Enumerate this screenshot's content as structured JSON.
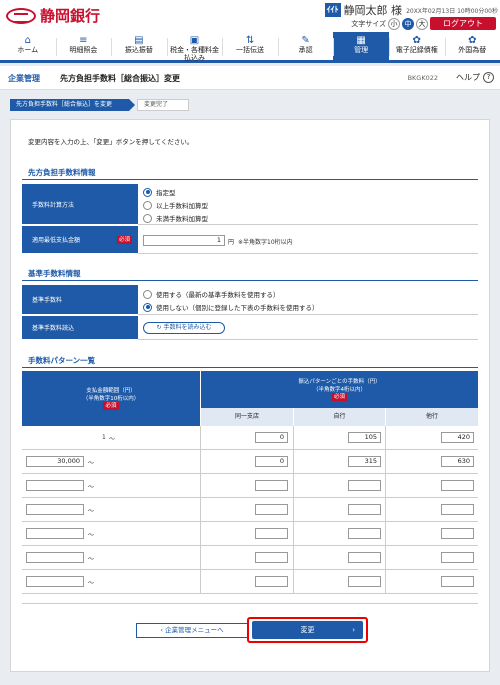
{
  "header": {
    "bank_name": "静岡銀行",
    "user_id_badge": "ｲｲﾄ",
    "user_name": "静岡太郎 様",
    "login_time": "20XX年02月13日 10時00分00秒",
    "text_size_label": "文字サイズ",
    "text_sizes": [
      "小",
      "中",
      "大"
    ],
    "logout_label": "ログアウト"
  },
  "nav": [
    {
      "label": "ホーム",
      "icon": "home-icon",
      "glyph": "⌂"
    },
    {
      "label": "明細照会",
      "icon": "list-icon",
      "glyph": "≡"
    },
    {
      "label": "振込振替",
      "icon": "transfer-icon",
      "glyph": "▤"
    },
    {
      "label": "税金・各種料金\n払込み",
      "icon": "tax-icon",
      "glyph": "▣"
    },
    {
      "label": "一括伝送",
      "icon": "batch-icon",
      "glyph": "⇅"
    },
    {
      "label": "承認",
      "icon": "approve-icon",
      "glyph": "✎"
    },
    {
      "label": "管理",
      "icon": "admin-icon",
      "glyph": "▦"
    },
    {
      "label": "電子記録債権",
      "icon": "e-claim-icon",
      "glyph": "✿"
    },
    {
      "label": "外国為替",
      "icon": "forex-icon",
      "glyph": "✿"
    }
  ],
  "titlebar": {
    "category": "企業管理",
    "title": "先方負担手数料［総合振込］変更",
    "page_id": "BKGK022",
    "help_label": "ヘルプ",
    "help_glyph": "?"
  },
  "steps": [
    "先方負担手数料［総合振込］を変更",
    "変更完了"
  ],
  "instruction": "変更内容を入力の上、「変更」ボタンを押してください。",
  "section1": {
    "heading": "先方負担手数料情報",
    "calc_label": "手数料計算方法",
    "calc_options": [
      "指定型",
      "以上手数料加算型",
      "未満手数料加算型"
    ],
    "calc_selected": 0,
    "min_label": "適用最低支払金額",
    "required": "必須",
    "min_value": "1",
    "min_unit": "円",
    "min_note": "※半角数字10桁以内"
  },
  "section2": {
    "heading": "基準手数料情報",
    "base_label": "基準手数料",
    "base_options": [
      "使用する（最新の基準手数料を使用する）",
      "使用しない（個別に登録した下表の手数料を使用する）"
    ],
    "base_selected": 1,
    "load_label": "基準手数料読込",
    "load_button": "手数料を読み込む"
  },
  "section3": {
    "heading": "手数料パターン一覧",
    "col_amount_line1": "支払金額範囲（円）",
    "col_amount_line2": "（半角数字10桁以内）",
    "col_fee_line1": "振込パターンごとの手数料（円）",
    "col_fee_line2": "（半角数字4桁以内）",
    "required": "必須",
    "sub_cols": [
      "同一支店",
      "自行",
      "他行"
    ],
    "tilde": "〜",
    "rows": [
      {
        "amount": "1",
        "amount_editable": false,
        "same_branch": "0",
        "own_bank": "105",
        "other_bank": "420"
      },
      {
        "amount": "30,000",
        "amount_editable": true,
        "same_branch": "0",
        "own_bank": "315",
        "other_bank": "630"
      },
      {
        "amount": "",
        "amount_editable": true,
        "same_branch": "",
        "own_bank": "",
        "other_bank": ""
      },
      {
        "amount": "",
        "amount_editable": true,
        "same_branch": "",
        "own_bank": "",
        "other_bank": ""
      },
      {
        "amount": "",
        "amount_editable": true,
        "same_branch": "",
        "own_bank": "",
        "other_bank": ""
      },
      {
        "amount": "",
        "amount_editable": true,
        "same_branch": "",
        "own_bank": "",
        "other_bank": ""
      },
      {
        "amount": "",
        "amount_editable": true,
        "same_branch": "",
        "own_bank": "",
        "other_bank": ""
      }
    ]
  },
  "buttons": {
    "back_label": "企業管理メニューへ",
    "change_label": "変更"
  },
  "colors": {
    "brand": "#c8102e",
    "primary": "#1e5aa8"
  }
}
